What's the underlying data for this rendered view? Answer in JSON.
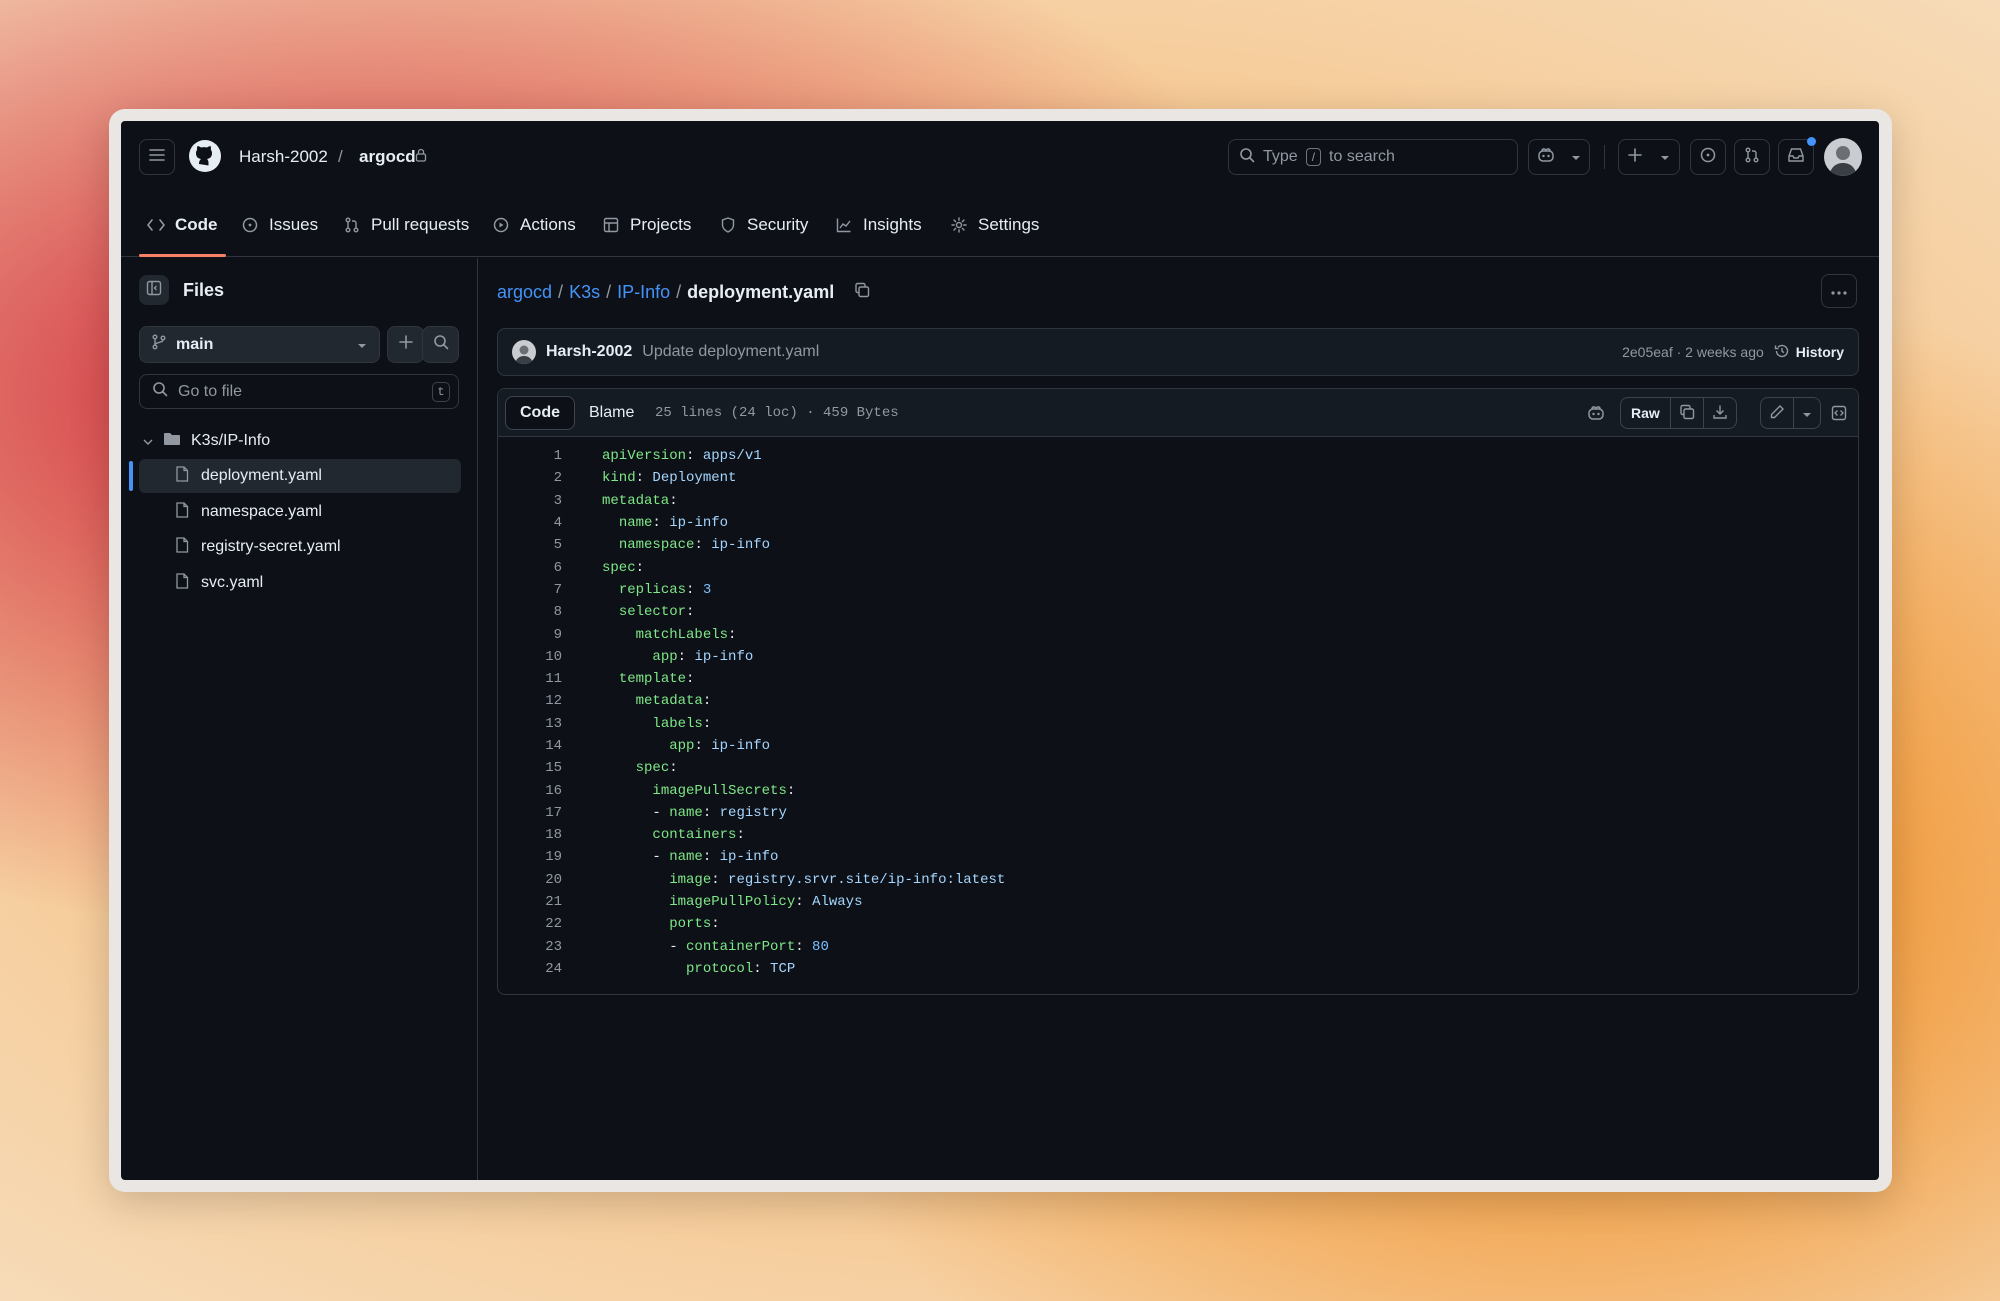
{
  "header": {
    "owner": "Harsh-2002",
    "separator": "/",
    "repo": "argocd",
    "search_prefix": "Type",
    "search_key": "/",
    "search_suffix": "to search"
  },
  "nav": {
    "tabs": [
      {
        "label": "Code",
        "icon": "code-icon"
      },
      {
        "label": "Issues",
        "icon": "issue-icon"
      },
      {
        "label": "Pull requests",
        "icon": "pull-request-icon"
      },
      {
        "label": "Actions",
        "icon": "play-icon"
      },
      {
        "label": "Projects",
        "icon": "table-icon"
      },
      {
        "label": "Security",
        "icon": "shield-icon"
      },
      {
        "label": "Insights",
        "icon": "graph-icon"
      },
      {
        "label": "Settings",
        "icon": "gear-icon"
      }
    ]
  },
  "sidebar": {
    "title": "Files",
    "branch": "main",
    "goto_placeholder": "Go to file",
    "goto_shortcut": "t",
    "folder": "K3s/IP-Info",
    "files": [
      "deployment.yaml",
      "namespace.yaml",
      "registry-secret.yaml",
      "svc.yaml"
    ],
    "selected_index": 0
  },
  "breadcrumb": {
    "parts": [
      "argocd",
      "K3s",
      "IP-Info"
    ],
    "separator": "/",
    "current": "deployment.yaml"
  },
  "commit": {
    "author": "Harsh-2002",
    "message": "Update deployment.yaml",
    "hash_time": "2e05eaf · 2 weeks ago",
    "history_label": "History"
  },
  "file_view": {
    "tab_code": "Code",
    "tab_blame": "Blame",
    "meta": "25 lines (24 loc) · 459 Bytes",
    "raw_label": "Raw"
  },
  "code_lines": [
    {
      "n": "1",
      "indent": "",
      "key": "apiVersion",
      "val": "apps/v1",
      "type": "v"
    },
    {
      "n": "2",
      "indent": "",
      "key": "kind",
      "val": "Deployment",
      "type": "v"
    },
    {
      "n": "3",
      "indent": "",
      "key": "metadata",
      "val": "",
      "type": "v"
    },
    {
      "n": "4",
      "indent": "  ",
      "key": "name",
      "val": "ip-info",
      "type": "v"
    },
    {
      "n": "5",
      "indent": "  ",
      "key": "namespace",
      "val": "ip-info",
      "type": "v"
    },
    {
      "n": "6",
      "indent": "",
      "key": "spec",
      "val": "",
      "type": "v"
    },
    {
      "n": "7",
      "indent": "  ",
      "key": "replicas",
      "val": "3",
      "type": "n"
    },
    {
      "n": "8",
      "indent": "  ",
      "key": "selector",
      "val": "",
      "type": "v"
    },
    {
      "n": "9",
      "indent": "    ",
      "key": "matchLabels",
      "val": "",
      "type": "v"
    },
    {
      "n": "10",
      "indent": "      ",
      "key": "app",
      "val": "ip-info",
      "type": "v"
    },
    {
      "n": "11",
      "indent": "  ",
      "key": "template",
      "val": "",
      "type": "v"
    },
    {
      "n": "12",
      "indent": "    ",
      "key": "metadata",
      "val": "",
      "type": "v"
    },
    {
      "n": "13",
      "indent": "      ",
      "key": "labels",
      "val": "",
      "type": "v"
    },
    {
      "n": "14",
      "indent": "        ",
      "key": "app",
      "val": "ip-info",
      "type": "v"
    },
    {
      "n": "15",
      "indent": "    ",
      "key": "spec",
      "val": "",
      "type": "v"
    },
    {
      "n": "16",
      "indent": "      ",
      "key": "imagePullSecrets",
      "val": "",
      "type": "v"
    },
    {
      "n": "17",
      "indent": "      - ",
      "key": "name",
      "val": "registry",
      "type": "v"
    },
    {
      "n": "18",
      "indent": "      ",
      "key": "containers",
      "val": "",
      "type": "v"
    },
    {
      "n": "19",
      "indent": "      - ",
      "key": "name",
      "val": "ip-info",
      "type": "v"
    },
    {
      "n": "20",
      "indent": "        ",
      "key": "image",
      "val": "registry.srvr.site/ip-info:latest",
      "type": "v"
    },
    {
      "n": "21",
      "indent": "        ",
      "key": "imagePullPolicy",
      "val": "Always",
      "type": "v"
    },
    {
      "n": "22",
      "indent": "        ",
      "key": "ports",
      "val": "",
      "type": "v"
    },
    {
      "n": "23",
      "indent": "        - ",
      "key": "containerPort",
      "val": "80",
      "type": "n"
    },
    {
      "n": "24",
      "indent": "          ",
      "key": "protocol",
      "val": "TCP",
      "type": "v"
    }
  ],
  "colors": {
    "background": "#0d1117",
    "accent": "#f78166",
    "link": "#4493f8",
    "yaml_key": "#7ee787",
    "yaml_value": "#a5d6ff"
  }
}
